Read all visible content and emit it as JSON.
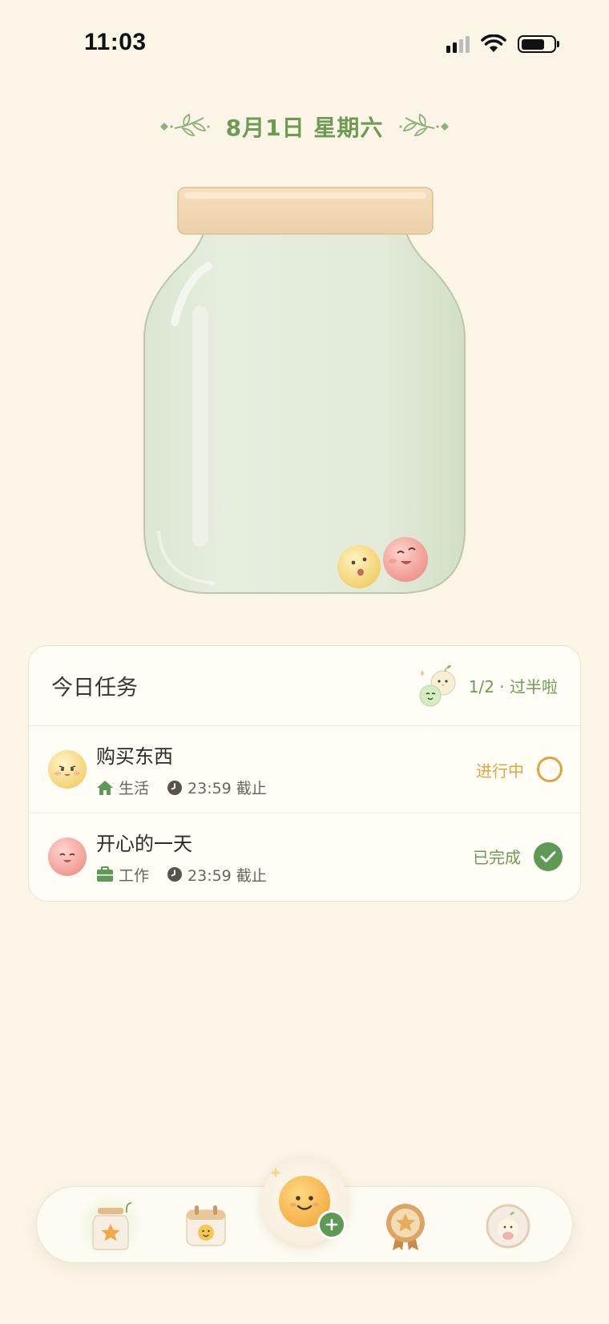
{
  "status_bar": {
    "time": "11:03",
    "icons": [
      "cellular-signal-icon",
      "wifi-icon",
      "battery-icon"
    ],
    "battery_level": 0.75
  },
  "header": {
    "date_text": "8月1日 星期六"
  },
  "jar": {
    "ball_count": 2,
    "ball_colors": [
      "#f4d36e",
      "#ef9c95"
    ]
  },
  "tasks_card": {
    "title": "今日任务",
    "progress": "1/2 · 过半啦",
    "items": [
      {
        "name": "购买东西",
        "category": "生活",
        "category_icon": "house-icon",
        "deadline": "23:59 截止",
        "status": "进行中",
        "done": false
      },
      {
        "name": "开心的一天",
        "category": "工作",
        "category_icon": "briefcase-icon",
        "deadline": "23:59 截止",
        "status": "已完成",
        "done": true
      }
    ]
  },
  "bottom_nav": {
    "items": [
      "jar-star-icon",
      "calendar-icon",
      "add-task-icon",
      "medal-icon",
      "profile-icon"
    ]
  },
  "colors": {
    "background": "#fbf5e8",
    "accent_green": "#6f9a52",
    "accent_orange": "#e1a53f",
    "check_green": "#5f9a54"
  }
}
